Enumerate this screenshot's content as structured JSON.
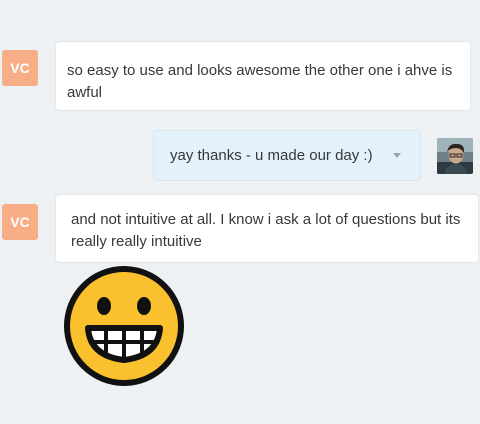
{
  "messages": [
    {
      "sender_initials": "VC",
      "text": "so easy to use and looks awesome the other one i ahve is awful"
    },
    {
      "text": "yay thanks - u made our day :)"
    },
    {
      "sender_initials": "VC",
      "text": "and not intuitive at all. I know i ask a lot of questions but its really really intuitive"
    }
  ],
  "colors": {
    "background": "#eef1f3",
    "vc_avatar": "#f7ae86",
    "outgoing_bubble": "#e4f1fa",
    "emoji_fill": "#fbc02d"
  },
  "icons": [
    "chevron-down-icon",
    "grinning-face-emoji"
  ]
}
